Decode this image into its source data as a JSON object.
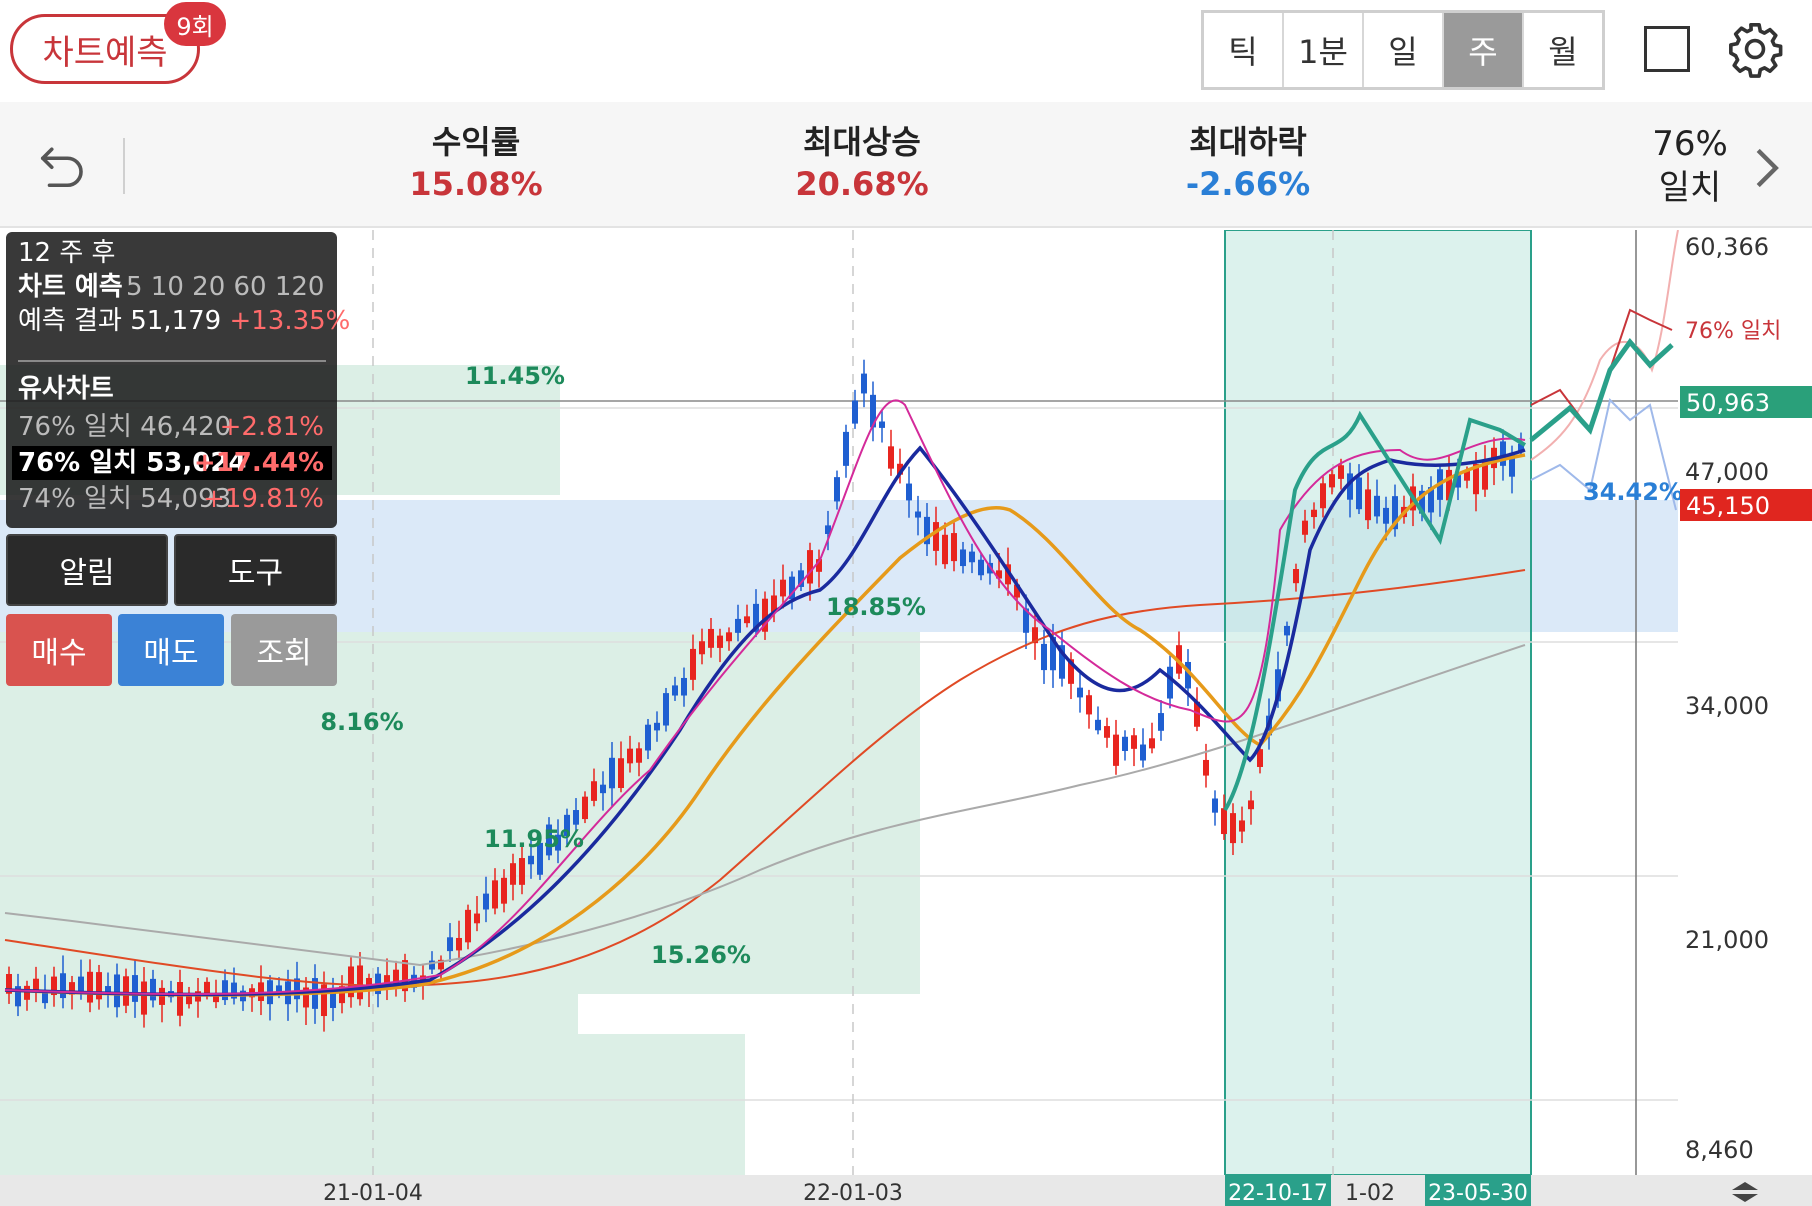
{
  "header": {
    "predict_label": "차트예측",
    "predict_badge": "9회",
    "periods": [
      "틱",
      "1분",
      "일",
      "주",
      "월"
    ],
    "active_period": "주",
    "icons": [
      "square-icon",
      "gear-icon"
    ]
  },
  "stats": {
    "return_label": "수익률",
    "return_value": "15.08%",
    "max_up_label": "최대상승",
    "max_up_value": "20.68%",
    "max_down_label": "최대하락",
    "max_down_value": "-2.66%",
    "match_pct": "76%",
    "match_label": "일치"
  },
  "info": {
    "weeks_after": "12 주 후",
    "title": "차트 예측",
    "result_label": "예측 결과",
    "result_value": "51,179",
    "result_pct": "+13.35%",
    "similar_title": "유사차트",
    "rows": [
      {
        "label": "76% 일치",
        "value": "46,420",
        "pct": "+2.81%"
      },
      {
        "label": "76% 일치",
        "value": "53,024",
        "pct": "+17.44%"
      },
      {
        "label": "74% 일치",
        "value": "54,093",
        "pct": "+19.81%"
      }
    ],
    "ma_legend": "5  10  20  60  120"
  },
  "buttons": {
    "alarm": "알림",
    "tools": "도구",
    "buy": "매수",
    "sell": "매도",
    "view": "조회"
  },
  "chart_data": {
    "type": "candlestick",
    "y_ticks": [
      "60,366",
      "47,000",
      "34,000",
      "21,000",
      "8,460"
    ],
    "x_ticks": [
      "21-01-04",
      "22-01-03"
    ],
    "range_start_label": "22-10-17",
    "range_end_label": "23-05-30",
    "partial_x_label": "1-02",
    "current_price": "50,963",
    "price_tag_red": "45,150",
    "match_tag": "76% 일치",
    "zone_pcts": [
      "11.45%",
      "18.85%",
      "8.16%",
      "11.95%",
      "15.26%",
      "34.42%"
    ]
  }
}
